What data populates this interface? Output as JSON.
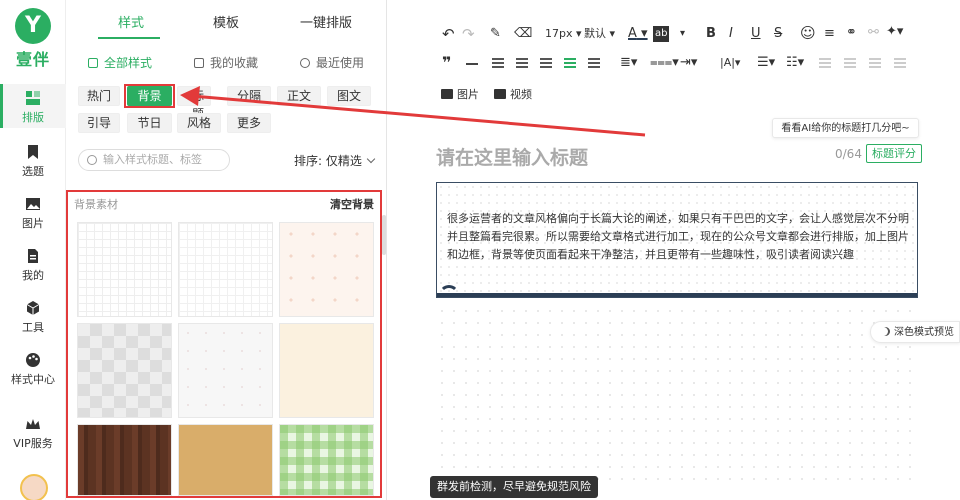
{
  "brand": {
    "logo_char": "Y",
    "name": "壹伴",
    "accent": "#2bae62"
  },
  "nav": {
    "items": [
      {
        "label": "排版",
        "icon": "layout-icon",
        "active": true
      },
      {
        "label": "选题",
        "icon": "bookmark-icon"
      },
      {
        "label": "图片",
        "icon": "image-icon"
      },
      {
        "label": "我的",
        "icon": "document-icon"
      },
      {
        "label": "工具",
        "icon": "cube-icon"
      },
      {
        "label": "样式中心",
        "icon": "palette-icon"
      },
      {
        "label": "VIP服务",
        "icon": "crown-icon"
      }
    ]
  },
  "panel": {
    "tabs": [
      "样式",
      "模板",
      "一键排版"
    ],
    "subtabs": [
      "全部样式",
      "我的收藏",
      "最近使用"
    ],
    "tags_row1": [
      "热门",
      "背景",
      "标题",
      "分隔",
      "正文",
      "图文"
    ],
    "tags_row2": [
      "引导",
      "节日",
      "风格",
      "更多"
    ],
    "active_tag": "背景",
    "search_placeholder": "输入样式标题、标签",
    "sort_label": "排序: 仅精选",
    "bg_section_label": "背景素材",
    "bg_clear_label": "清空背景"
  },
  "editor": {
    "toolbar": {
      "font_size": "17px",
      "font_family": "默认",
      "color_letter": "A",
      "bold": "B",
      "italic": "I",
      "underline": "U",
      "strike": "S"
    },
    "media": {
      "image": "图片",
      "video": "视频"
    },
    "ai_tip": "看看AI给你的标题打几分吧~",
    "title_placeholder": "请在这里输入标题",
    "title_count": "0/64",
    "score_button": "标题评分",
    "content_text": "很多运营者的文章风格偏向于长篇大论的阐述，如果只有干巴巴的文字，会让人感觉层次不分明并且整篇看完很累。所以需要给文章格式进行加工，现在的公众号文章都会进行排版，加上图片和边框，背景等使页面看起来干净整洁，并且更带有一些趣味性，吸引读者阅读兴趣",
    "dark_mode_label": "深色模式预览",
    "bottom_tooltip": "群发前检测，尽早避免规范风险"
  }
}
